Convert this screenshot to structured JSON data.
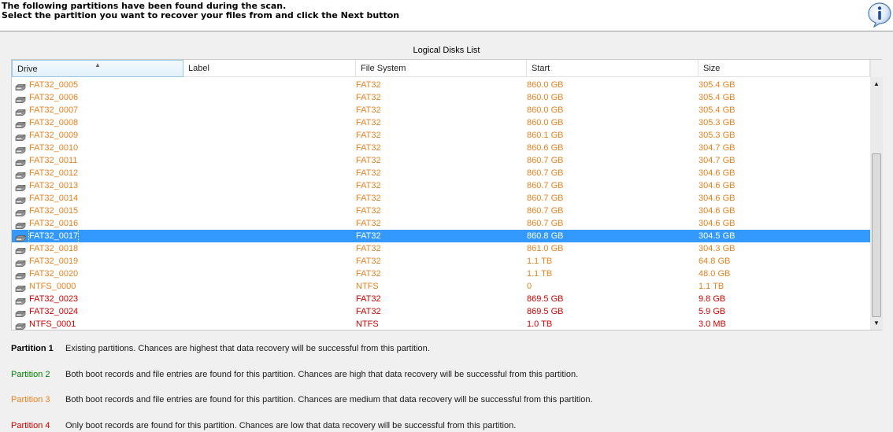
{
  "header": {
    "line1": "The following partitions have been found during the scan.",
    "line2": "Select the partition you want to recover your files from and click the Next button",
    "info_icon": "info-icon"
  },
  "list": {
    "title": "Logical Disks List",
    "columns": [
      "Drive",
      "Label",
      "File System",
      "Start",
      "Size"
    ],
    "sorted_column": "Drive",
    "rows": [
      {
        "drive": "FAT32_0005",
        "label": "",
        "fs": "FAT32",
        "start": "860.0 GB",
        "size": "305.4 GB",
        "status": 3
      },
      {
        "drive": "FAT32_0006",
        "label": "",
        "fs": "FAT32",
        "start": "860.0 GB",
        "size": "305.4 GB",
        "status": 3
      },
      {
        "drive": "FAT32_0007",
        "label": "",
        "fs": "FAT32",
        "start": "860.0 GB",
        "size": "305.4 GB",
        "status": 3
      },
      {
        "drive": "FAT32_0008",
        "label": "",
        "fs": "FAT32",
        "start": "860.0 GB",
        "size": "305.3 GB",
        "status": 3
      },
      {
        "drive": "FAT32_0009",
        "label": "",
        "fs": "FAT32",
        "start": "860.1 GB",
        "size": "305.3 GB",
        "status": 3
      },
      {
        "drive": "FAT32_0010",
        "label": "",
        "fs": "FAT32",
        "start": "860.6 GB",
        "size": "304.7 GB",
        "status": 3
      },
      {
        "drive": "FAT32_0011",
        "label": "",
        "fs": "FAT32",
        "start": "860.7 GB",
        "size": "304.7 GB",
        "status": 3
      },
      {
        "drive": "FAT32_0012",
        "label": "",
        "fs": "FAT32",
        "start": "860.7 GB",
        "size": "304.6 GB",
        "status": 3
      },
      {
        "drive": "FAT32_0013",
        "label": "",
        "fs": "FAT32",
        "start": "860.7 GB",
        "size": "304.6 GB",
        "status": 3
      },
      {
        "drive": "FAT32_0014",
        "label": "",
        "fs": "FAT32",
        "start": "860.7 GB",
        "size": "304.6 GB",
        "status": 3
      },
      {
        "drive": "FAT32_0015",
        "label": "",
        "fs": "FAT32",
        "start": "860.7 GB",
        "size": "304.6 GB",
        "status": 3
      },
      {
        "drive": "FAT32_0016",
        "label": "",
        "fs": "FAT32",
        "start": "860.7 GB",
        "size": "304.6 GB",
        "status": 3
      },
      {
        "drive": "FAT32_0017",
        "label": "",
        "fs": "FAT32",
        "start": "860.8 GB",
        "size": "304.5 GB",
        "status": 3,
        "selected": true
      },
      {
        "drive": "FAT32_0018",
        "label": "",
        "fs": "FAT32",
        "start": "861.0 GB",
        "size": "304.3 GB",
        "status": 3
      },
      {
        "drive": "FAT32_0019",
        "label": "",
        "fs": "FAT32",
        "start": "1.1 TB",
        "size": "64.8 GB",
        "status": 3
      },
      {
        "drive": "FAT32_0020",
        "label": "",
        "fs": "FAT32",
        "start": "1.1 TB",
        "size": "48.0 GB",
        "status": 3
      },
      {
        "drive": "NTFS_0000",
        "label": "",
        "fs": "NTFS",
        "start": "0",
        "size": "1.1 TB",
        "status": 3
      },
      {
        "drive": "FAT32_0023",
        "label": "",
        "fs": "FAT32",
        "start": "869.5 GB",
        "size": "9.8 GB",
        "status": 4
      },
      {
        "drive": "FAT32_0024",
        "label": "",
        "fs": "FAT32",
        "start": "869.5 GB",
        "size": "5.9 GB",
        "status": 4
      },
      {
        "drive": "NTFS_0001",
        "label": "",
        "fs": "NTFS",
        "start": "1.0 TB",
        "size": "3.0 MB",
        "status": 4
      }
    ]
  },
  "legend": [
    {
      "name": "Partition 1",
      "desc": "Existing partitions. Chances are highest that data recovery will be successful from this partition.",
      "color": "#000000"
    },
    {
      "name": "Partition 2",
      "desc": "Both boot records and file entries are found for this partition. Chances are high that data recovery will be successful from this partition.",
      "color": "#008000"
    },
    {
      "name": "Partition 3",
      "desc": "Both boot records and file entries are found for this partition. Chances are medium that data recovery will be successful from this partition.",
      "color": "#e8821e"
    },
    {
      "name": "Partition 4",
      "desc": "Only boot records are found for this partition. Chances are low that data recovery will be successful from this partition.",
      "color": "#d40000"
    }
  ],
  "colors": {
    "status3": "#e8821e",
    "status4": "#d40000",
    "selection": "#3399ff"
  }
}
